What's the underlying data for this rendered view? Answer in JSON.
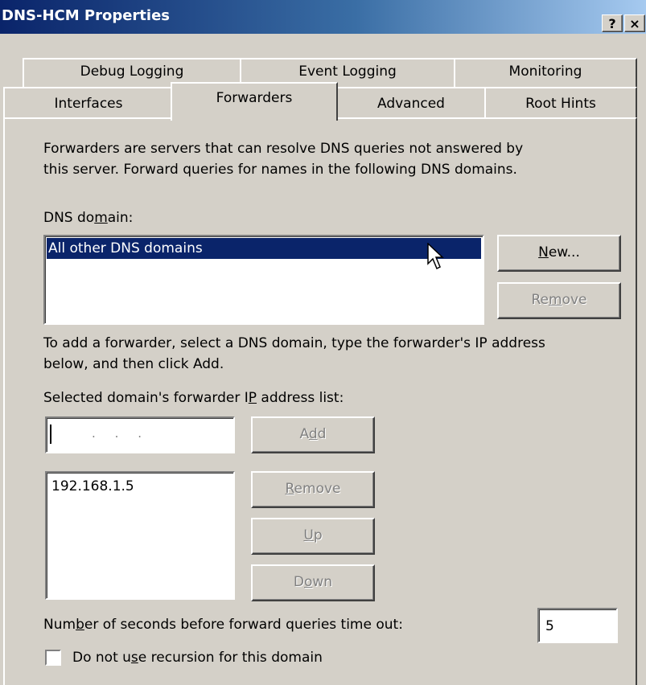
{
  "window": {
    "title": "DNS-HCM Properties",
    "help_button": "?",
    "close_button": "×"
  },
  "tabs": {
    "row1": [
      "Debug Logging",
      "Event Logging",
      "Monitoring"
    ],
    "row2": [
      "Interfaces",
      "Forwarders",
      "Advanced",
      "Root Hints"
    ],
    "active": "Forwarders"
  },
  "forwarders": {
    "description_line1": "Forwarders are servers that can resolve DNS queries not answered by",
    "description_line2": "this server. Forward queries for names in the following DNS domains.",
    "dns_domain_label_pre": "DNS do",
    "dns_domain_label_u": "m",
    "dns_domain_label_post": "ain:",
    "domains": [
      "All other DNS domains"
    ],
    "new_button": {
      "u": "N",
      "rest": "ew..."
    },
    "remove_domain_button": {
      "pre": "Re",
      "u": "m",
      "post": "ove"
    },
    "instructions_line1": "To add a forwarder, select a DNS domain, type the forwarder's IP address",
    "instructions_line2": "below, and then click Add.",
    "ip_list_label_pre": "Selected domain's forwarder I",
    "ip_list_label_u": "P",
    "ip_list_label_post": " address list:",
    "ip_input_dots": ".     .     .",
    "add_button": {
      "pre": "A",
      "u": "d",
      "post": "d"
    },
    "ip_addresses": [
      "192.168.1.5"
    ],
    "remove_ip_button": {
      "u": "R",
      "rest": "emove"
    },
    "up_button": {
      "u": "U",
      "rest": "p"
    },
    "down_button": {
      "pre": "D",
      "u": "o",
      "post": "wn"
    },
    "timeout_label_pre": "Num",
    "timeout_label_u": "b",
    "timeout_label_post": "er of seconds before forward queries time out:",
    "timeout_value": "5",
    "recursion_label_pre": "Do not u",
    "recursion_label_u": "s",
    "recursion_label_post": "e recursion for this domain",
    "recursion_checked": false
  },
  "colors": {
    "title_gradient_start": "#0a246a",
    "title_gradient_end": "#a6caf0",
    "selection": "#0a246a",
    "dialog_face": "#d4d0c8"
  }
}
